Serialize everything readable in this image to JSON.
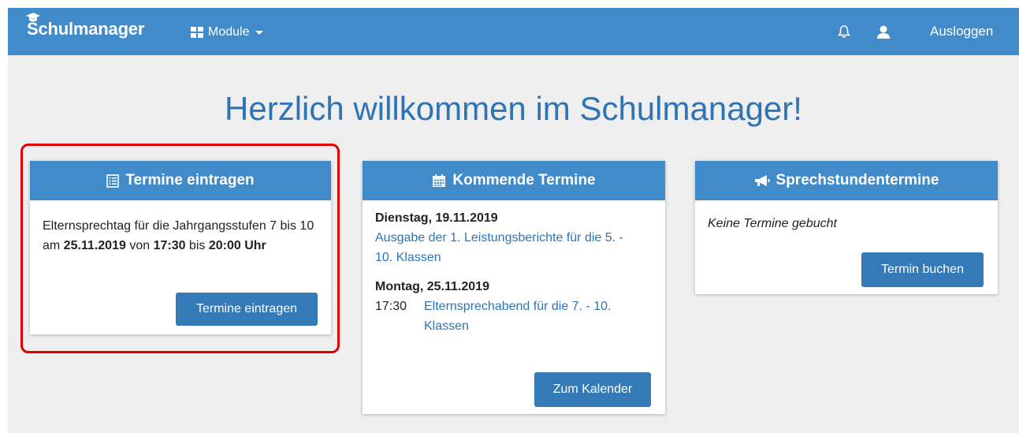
{
  "navbar": {
    "brand": "Schulmanager",
    "modules_label": "Module",
    "logout_label": "Ausloggen",
    "color": "#428bca"
  },
  "headline": "Herzlich willkommen im Schulmanager!",
  "cards": {
    "termine_eintragen": {
      "title": "Termine eintragen",
      "text_1": "Elternsprechtag für die Jahrgangsstufen 7 bis 10 am ",
      "date": "25.11.2019",
      "text_2": " von ",
      "start": "17:30",
      "text_3": " bis ",
      "end": "20:00 Uhr",
      "button": "Termine eintragen"
    },
    "kommende_termine": {
      "title": "Kommende Termine",
      "events": [
        {
          "day": "Dienstag, 19.11.2019",
          "time": "",
          "text": "Ausgabe der 1. Leistungsberichte für die 5. - 10. Klassen"
        },
        {
          "day": "Montag, 25.11.2019",
          "time": "17:30",
          "text": "Elternsprechabend für die 7. - 10. Klassen"
        }
      ],
      "button": "Zum Kalender"
    },
    "sprechstunden": {
      "title": "Sprechstundentermine",
      "empty_text": "Keine Termine gebucht",
      "button": "Termin buchen"
    }
  },
  "icons": [
    "graduation-cap-icon",
    "grid-icon",
    "bell-icon",
    "user-icon",
    "list-icon",
    "calendar-icon",
    "megaphone-icon"
  ]
}
